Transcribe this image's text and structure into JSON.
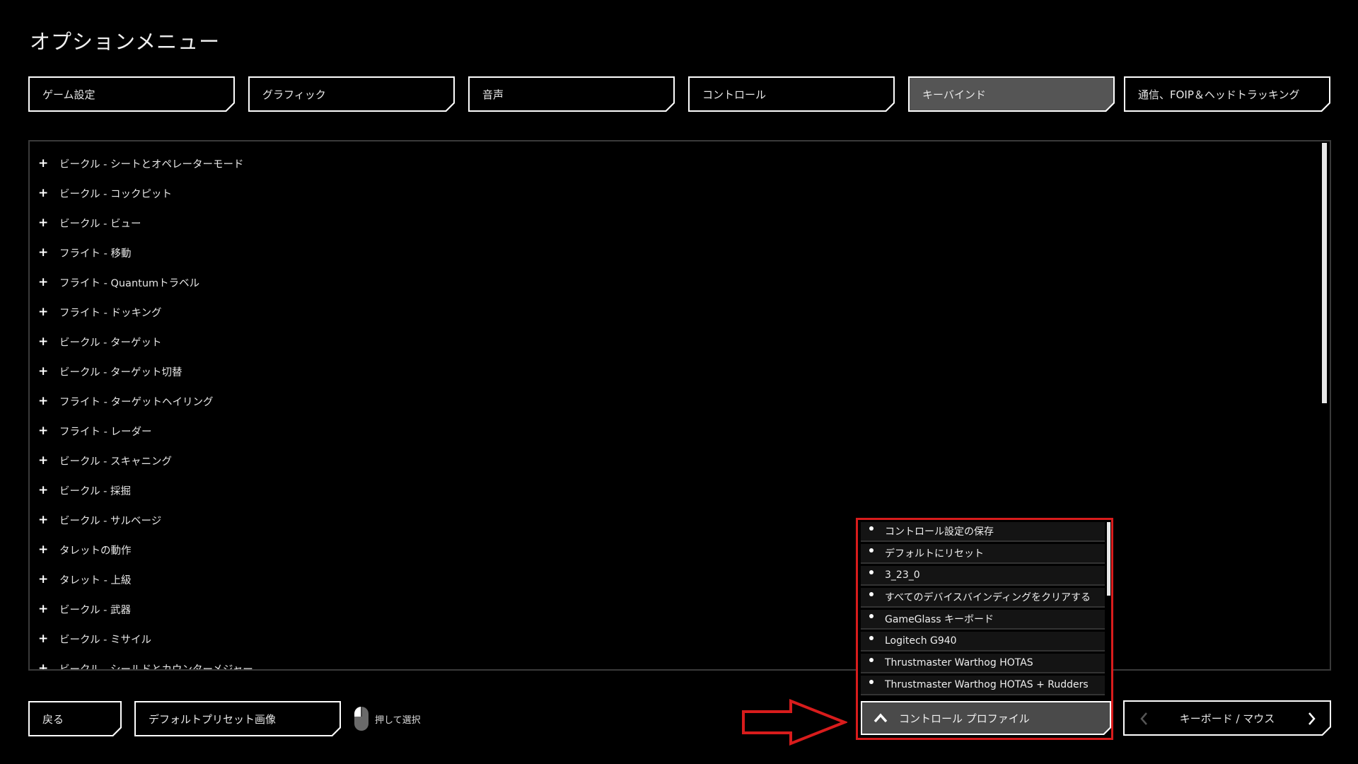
{
  "page": {
    "title": "オプションメニュー"
  },
  "tabs": [
    {
      "label": "ゲーム設定",
      "active": false
    },
    {
      "label": "グラフィック",
      "active": false
    },
    {
      "label": "音声",
      "active": false
    },
    {
      "label": "コントロール",
      "active": false
    },
    {
      "label": "キーバインド",
      "active": true
    },
    {
      "label": "通信、FOIP＆ヘッドトラッキング",
      "active": false
    }
  ],
  "categories": [
    "ビークル - シートとオペレーターモード",
    "ビークル - コックピット",
    "ビークル - ビュー",
    "フライト - 移動",
    "フライト - Quantumトラベル",
    "フライト - ドッキング",
    "ビークル - ターゲット",
    "ビークル - ターゲット切替",
    "フライト - ターゲットヘイリング",
    "フライト - レーダー",
    "ビークル - スキャニング",
    "ビークル - 採掘",
    "ビークル - サルベージ",
    "タレットの動作",
    "タレット - 上級",
    "ビークル - 武器",
    "ビークル - ミサイル",
    "ビークル - シールドとカウンターメジャー"
  ],
  "category_expand_symbol": "+",
  "profile_menu": {
    "items": [
      "コントロール設定の保存",
      "デフォルトにリセット",
      "3_23_0",
      "すべてのデバイスバインディングをクリアする",
      "GameGlass キーボード",
      "Logitech G940",
      "Thrustmaster Warthog HOTAS",
      "Thrustmaster Warthog HOTAS + Rudders"
    ],
    "button_label": "コントロール プロファイル",
    "highlight_color": "#d81c1c"
  },
  "footer": {
    "back_label": "戻る",
    "preset_label": "デフォルトプリセット画像",
    "mouse_hint": "押して選択",
    "device_label": "キーボード / マウス"
  },
  "colors": {
    "background": "#000000",
    "active_tab": "#555555",
    "annotation_red": "#d81c1c"
  }
}
